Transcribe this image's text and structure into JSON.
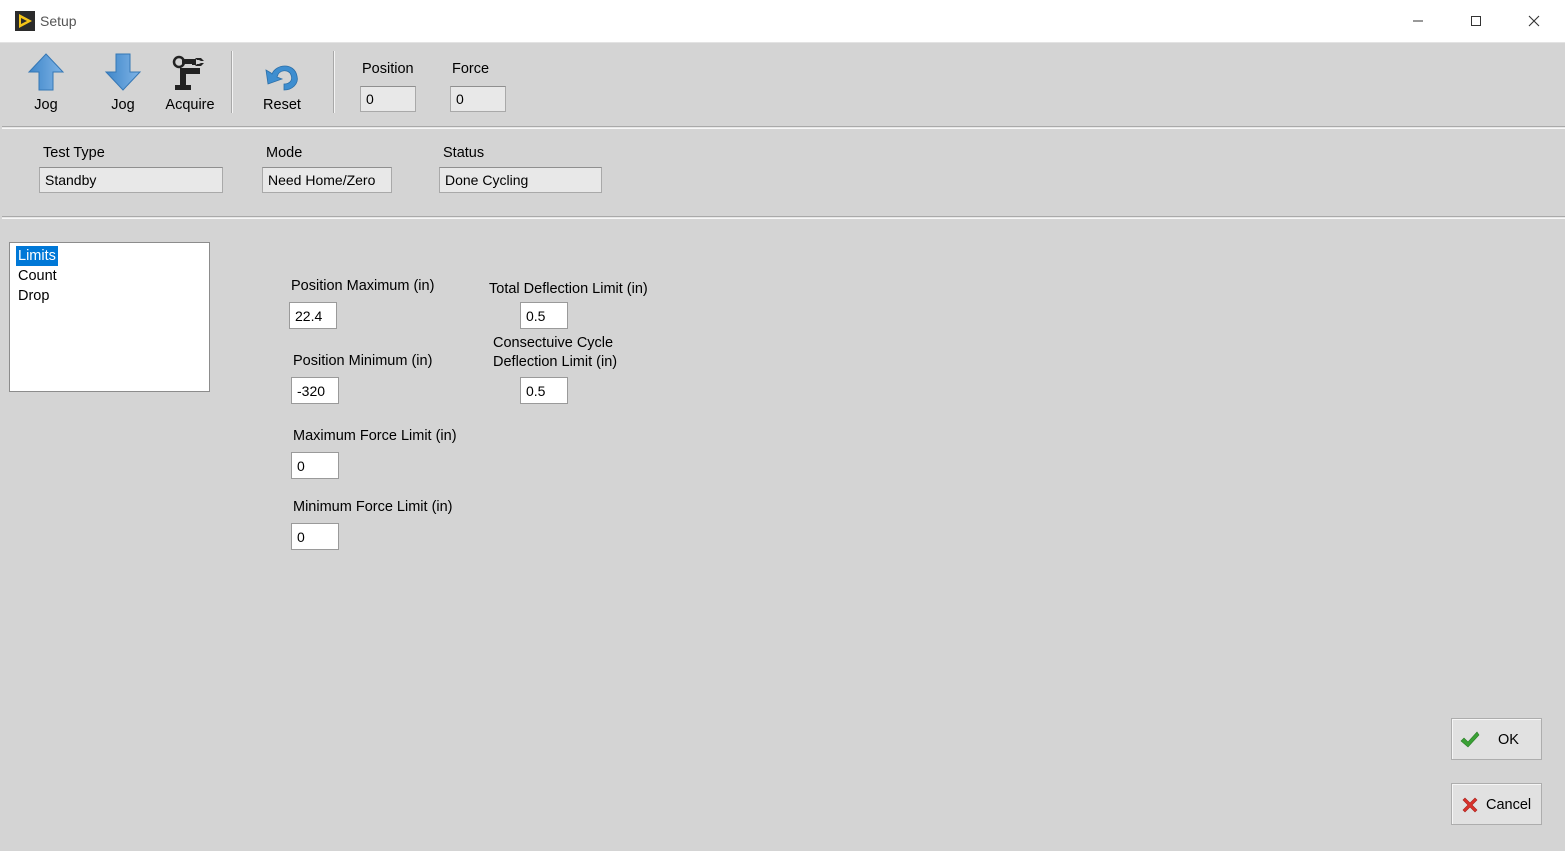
{
  "window": {
    "title": "Setup",
    "icons": {
      "app": "labview-run-icon",
      "minimize": "minimize-icon",
      "maximize": "maximize-icon",
      "close": "close-icon"
    }
  },
  "toolbar": {
    "jog_up_label": "Jog",
    "jog_down_label": "Jog",
    "acquire_label": "Acquire",
    "reset_label": "Reset",
    "position_label": "Position",
    "position_value": "0",
    "force_label": "Force",
    "force_value": "0"
  },
  "status_bar": {
    "test_type_label": "Test Type",
    "test_type_value": "Standby",
    "mode_label": "Mode",
    "mode_value": "Need Home/Zero",
    "status_label": "Status",
    "status_value": "Done Cycling"
  },
  "sidebar": {
    "items": [
      {
        "label": "Limits",
        "selected": true
      },
      {
        "label": "Count",
        "selected": false
      },
      {
        "label": "Drop",
        "selected": false
      }
    ]
  },
  "limits": {
    "position_max_label": "Position Maximum (in)",
    "position_max_value": "22.4",
    "position_min_label": "Position Minimum (in)",
    "position_min_value": "-320",
    "max_force_label": "Maximum Force Limit (in)",
    "max_force_value": "0",
    "min_force_label": "Minimum Force Limit (in)",
    "min_force_value": "0",
    "total_deflection_label": "Total Deflection Limit (in)",
    "total_deflection_value": "0.5",
    "consecutive_label_line1": "Consectuive Cycle",
    "consecutive_label_line2": "Deflection Limit (in)",
    "consecutive_value": "0.5"
  },
  "buttons": {
    "ok_label": "OK",
    "cancel_label": "Cancel"
  },
  "colors": {
    "background": "#d4d4d4",
    "selection": "#0078d7",
    "arrow_blue": "#5b9bd5",
    "ok_green": "#3aa135",
    "cancel_red": "#d9322b"
  }
}
